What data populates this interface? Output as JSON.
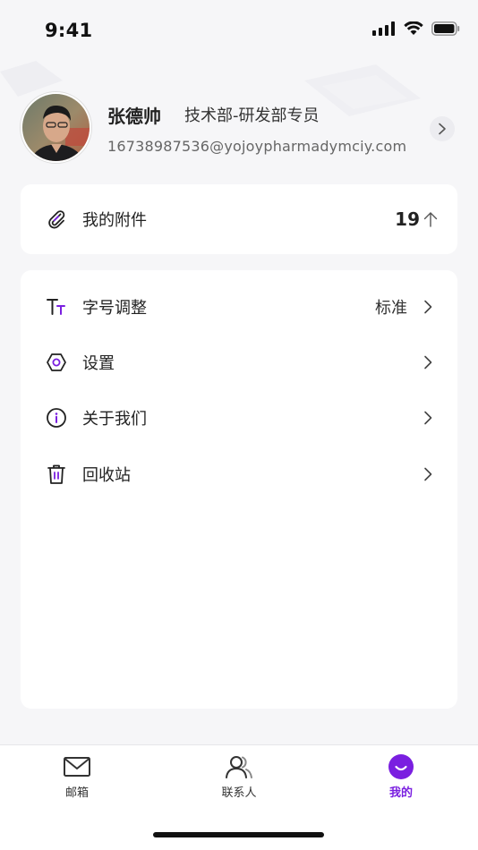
{
  "status": {
    "time": "9:41"
  },
  "profile": {
    "name": "张德帅",
    "department": "技术部-研发部专员",
    "email": "16738987536@yojoypharmadymciy.com"
  },
  "attachments": {
    "label": "我的附件",
    "count": "19"
  },
  "menu": [
    {
      "label": "字号调整",
      "value": "标准",
      "icon": "font-size-icon"
    },
    {
      "label": "设置",
      "value": "",
      "icon": "settings-icon"
    },
    {
      "label": "关于我们",
      "value": "",
      "icon": "info-icon"
    },
    {
      "label": "回收站",
      "value": "",
      "icon": "trash-icon"
    }
  ],
  "tabs": [
    {
      "label": "邮箱",
      "icon": "mail-icon",
      "active": false
    },
    {
      "label": "联系人",
      "icon": "contacts-icon",
      "active": false
    },
    {
      "label": "我的",
      "icon": "me-icon",
      "active": true
    }
  ],
  "colors": {
    "accent": "#7a1fe0",
    "background": "#f6f6f8"
  }
}
